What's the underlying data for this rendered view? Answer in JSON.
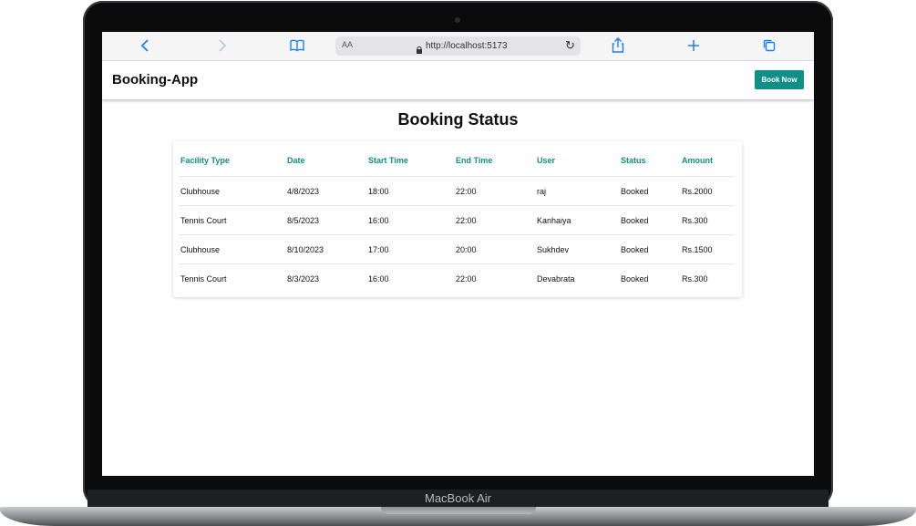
{
  "device": {
    "label": "MacBook Air"
  },
  "browser": {
    "text_size_label": "AA",
    "url": "http://localhost:5173"
  },
  "app": {
    "brand": "Booking-App",
    "book_button_label": "Book Now",
    "page_title": "Booking Status",
    "accent_color": "#0f8f87"
  },
  "table": {
    "columns": [
      "Facility Type",
      "Date",
      "Start Time",
      "End Time",
      "User",
      "Status",
      "Amount"
    ],
    "rows": [
      [
        "Clubhouse",
        "4/8/2023",
        "18:00",
        "22:00",
        "raj",
        "Booked",
        "Rs.2000"
      ],
      [
        "Tennis Court",
        "8/5/2023",
        "16:00",
        "22:00",
        "Kanhaiya",
        "Booked",
        "Rs.300"
      ],
      [
        "Clubhouse",
        "8/10/2023",
        "17:00",
        "20:00",
        "Sukhdev",
        "Booked",
        "Rs.1500"
      ],
      [
        "Tennis Court",
        "8/3/2023",
        "16:00",
        "22:00",
        "Devabrata",
        "Booked",
        "Rs.300"
      ]
    ]
  }
}
